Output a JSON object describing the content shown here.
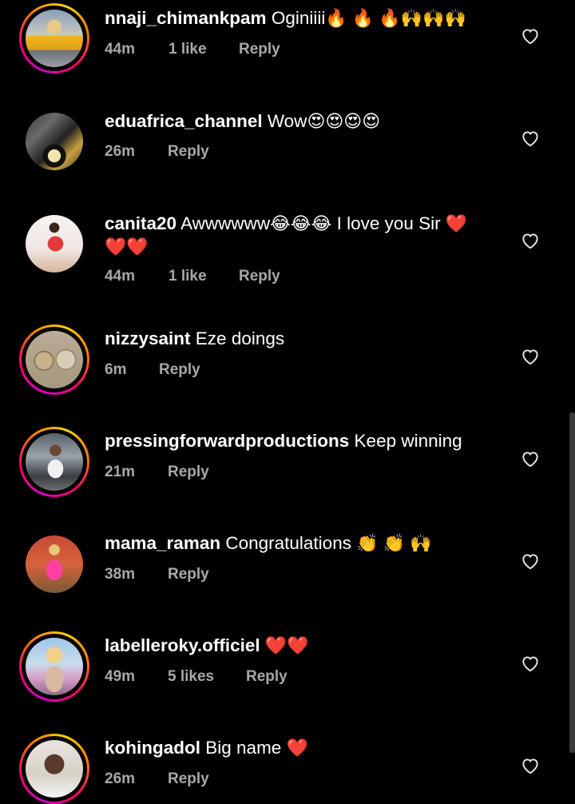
{
  "comments": [
    {
      "username": "nnaji_chimankpam",
      "text": "Oginiiii",
      "emoji": "🔥 🔥 🔥🙌🙌🙌",
      "time": "44m",
      "likes": "1 like",
      "reply": "Reply"
    },
    {
      "username": "eduafrica_channel",
      "text": "Wow",
      "emoji": "😍😍😍😍",
      "time": "26m",
      "likes": "",
      "reply": "Reply"
    },
    {
      "username": "canita20",
      "text": "Awwwwww",
      "emoji": "😂😂😂",
      "text2": "I love you Sir",
      "emoji2": "❤️",
      "emoji3": "❤️❤️",
      "time": "44m",
      "likes": "1 like",
      "reply": "Reply"
    },
    {
      "username": "nizzysaint",
      "text": "Eze doings",
      "emoji": "",
      "time": "6m",
      "likes": "",
      "reply": "Reply"
    },
    {
      "username": "pressingforwardproductions",
      "text": "Keep winning",
      "emoji": "",
      "time": "21m",
      "likes": "",
      "reply": "Reply"
    },
    {
      "username": "mama_raman",
      "text": "Congratulations",
      "emoji": "👏 👏 🙌",
      "time": "38m",
      "likes": "",
      "reply": "Reply"
    },
    {
      "username": "labelleroky.officiel",
      "text": "",
      "emoji": "❤️❤️",
      "time": "49m",
      "likes": "5 likes",
      "reply": "Reply"
    },
    {
      "username": "kohingadol",
      "text": "Big name",
      "emoji": "❤️",
      "time": "26m",
      "likes": "",
      "reply": "Reply"
    }
  ],
  "icons": {
    "like": "heart-outline-icon"
  },
  "colors": {
    "story_ring_start": "#d300c5",
    "story_ring_end": "#ffd600",
    "meta_text": "#a8a8a8",
    "background": "#000000"
  }
}
